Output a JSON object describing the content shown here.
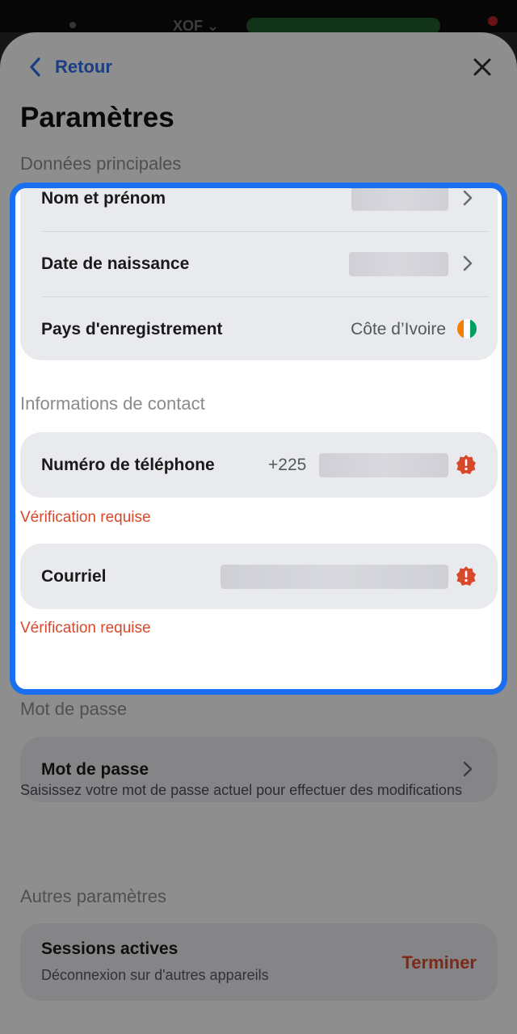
{
  "status_bar": {
    "currency_text": "XOF ⌄"
  },
  "header": {
    "back_label": "Retour",
    "title": "Paramètres"
  },
  "main_data": {
    "section_label": "Données principales",
    "rows": [
      {
        "label": "Nom et prénom",
        "value": ""
      },
      {
        "label": "Date de naissance",
        "value": ""
      },
      {
        "label": "Pays d'enregistrement",
        "value": "Côte d’Ivoire",
        "flag_colors": [
          "#f77f00",
          "#ffffff",
          "#009e60"
        ]
      }
    ]
  },
  "contact": {
    "section_label": "Informations de contact",
    "phone": {
      "label": "Numéro de téléphone",
      "prefix": "+225",
      "warning": "Vérification requise"
    },
    "email": {
      "label": "Courriel",
      "warning": "Vérification requise"
    }
  },
  "password": {
    "section_label": "Mot de passe",
    "row_label": "Mot de passe",
    "helper": "Saisissez votre mot de passe actuel pour effectuer des modifications"
  },
  "other": {
    "section_label": "Autres paramètres",
    "sessions": {
      "title": "Sessions actives",
      "subtitle": "Déconnexion sur d'autres appareils",
      "action": "Terminer"
    }
  },
  "colors": {
    "accent": "#2d6cdf",
    "highlight_border": "#1a6ff0",
    "warning": "#d8482a"
  },
  "icons": {
    "back": "chevron-left-icon",
    "close": "close-icon",
    "row_arrow": "chevron-right-icon",
    "alert": "warning-badge-icon"
  }
}
